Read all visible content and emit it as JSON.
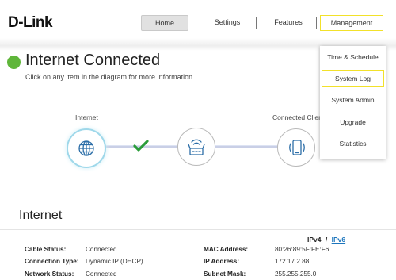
{
  "header": {
    "logo": "D-Link",
    "nav": [
      {
        "label": "Home"
      },
      {
        "label": "Settings"
      },
      {
        "label": "Features"
      },
      {
        "label": "Management"
      }
    ]
  },
  "status": {
    "title": "Internet Connected",
    "subtitle": "Click on any item in the diagram for more information.",
    "indicator_color": "#5fb63a"
  },
  "diagram": {
    "internet_label": "Internet",
    "clients_label": "Connected Clients",
    "link_status_icon": "check-icon"
  },
  "management_menu": {
    "items": [
      {
        "label": "Time & Schedule"
      },
      {
        "label": "System Log"
      },
      {
        "label": "System Admin"
      },
      {
        "label": "Upgrade"
      },
      {
        "label": "Statistics"
      }
    ]
  },
  "internet_section": {
    "title": "Internet",
    "ipv4": "IPv4",
    "separator": "/",
    "ipv6": "IPv6",
    "left": [
      {
        "label": "Cable Status:",
        "value": "Connected"
      },
      {
        "label": "Connection Type:",
        "value": "Dynamic IP (DHCP)"
      },
      {
        "label": "Network Status:",
        "value": "Connected"
      }
    ],
    "right": [
      {
        "label": "MAC Address:",
        "value": "80:26:89:5F:FE:F6"
      },
      {
        "label": "IP Address:",
        "value": "172.17.2.88"
      },
      {
        "label": "Subnet Mask:",
        "value": "255.255.255.0"
      }
    ]
  },
  "colors": {
    "highlight": "#f2e12a",
    "link": "#1d76bd",
    "check": "#2a9d3a",
    "globe": "#2c6ea8"
  }
}
